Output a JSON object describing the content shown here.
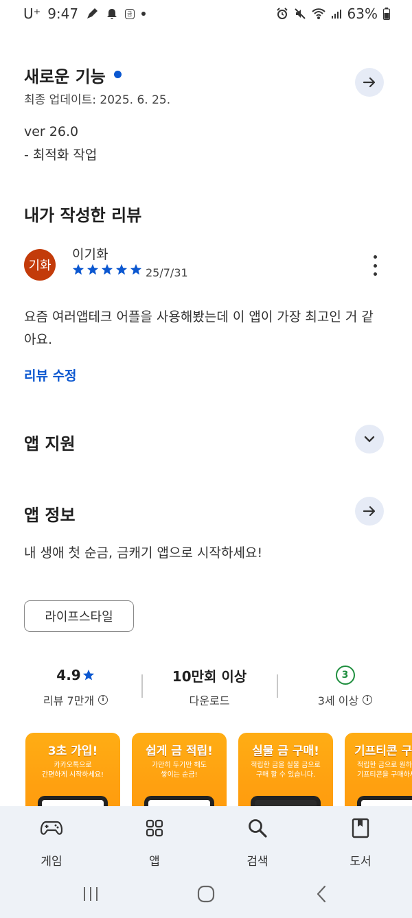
{
  "status_bar": {
    "carrier": "U⁺",
    "time": "9:47",
    "battery": "63%"
  },
  "whats_new": {
    "title": "새로운 기능",
    "updated": "최종 업데이트: 2025. 6. 25.",
    "version": "ver 26.0",
    "note": "- 최적화 작업"
  },
  "my_review": {
    "title": "내가 작성한 리뷰",
    "avatar_text": "기화",
    "reviewer_name": "이기화",
    "rating": 5,
    "date": "25/7/31",
    "text": "요즘 여러앱테크 어플을 사용해봤는데 이 앱이 가장 최고인 거 같아요.",
    "edit_link": "리뷰 수정"
  },
  "app_support": {
    "title": "앱 지원"
  },
  "app_info": {
    "title": "앱 정보",
    "description": "내 생애 첫 순금, 금캐기 앱으로 시작하세요!",
    "category_chip": "라이프스타일"
  },
  "stats": {
    "rating_value": "4.9",
    "rating_label": "리뷰 7만개",
    "downloads_value": "10만회 이상",
    "downloads_label": "다운로드",
    "age_badge": "3",
    "age_label": "3세 이상"
  },
  "screenshots": [
    {
      "title": "3초 가입!",
      "line1": "카카오톡으로",
      "line2": "간편하게 시작하세요!"
    },
    {
      "title": "쉽게 금 적립!",
      "line1": "가만히 두기만 해도",
      "line2": "쌓이는 순금!"
    },
    {
      "title": "실물 금 구매!",
      "line1": "적립한 금을 실물 금으로",
      "line2": "구매 할 수 있습니다."
    },
    {
      "title": "기프티콘 구",
      "line1": "적립한 금으로 원하",
      "line2": "기프티콘을 구매하세"
    }
  ],
  "bottom_nav": [
    {
      "label": "게임",
      "icon": "gamepad-icon"
    },
    {
      "label": "앱",
      "icon": "apps-grid-icon"
    },
    {
      "label": "검색",
      "icon": "search-icon"
    },
    {
      "label": "도서",
      "icon": "book-icon"
    }
  ],
  "colors": {
    "accent_blue": "#0b57d0",
    "avatar_bg": "#c33b0a",
    "age_green": "#1e8e3e",
    "nav_bg": "#eef2f7",
    "screenshot_orange": "#ffa010"
  }
}
